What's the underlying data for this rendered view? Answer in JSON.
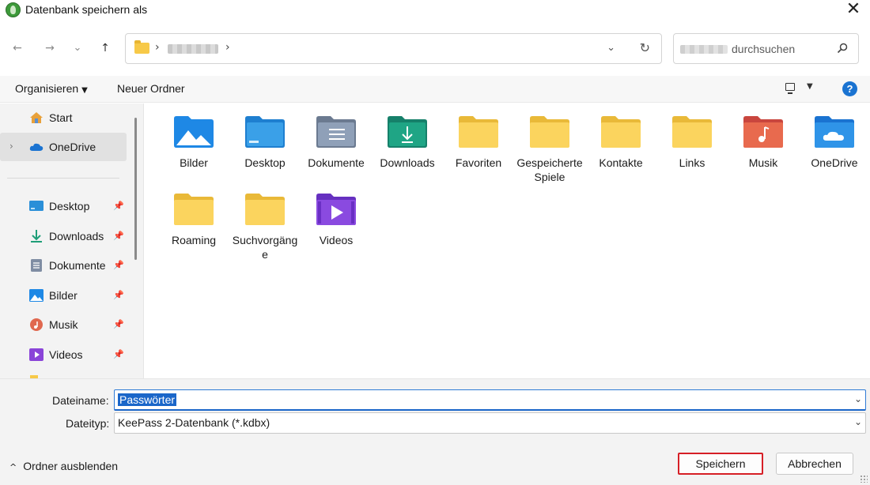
{
  "window": {
    "title": "Datenbank speichern als",
    "close_glyph": "✕"
  },
  "nav": {
    "back_glyph": "←",
    "forward_glyph": "→",
    "recent_glyph": "⌄",
    "up_glyph": "↑",
    "breadcrumb_separator": "›",
    "search_suffix": "durchsuchen",
    "address_dropdown_glyph": "⌄",
    "refresh_glyph": "↻"
  },
  "commandbar": {
    "organize_label": "Organisieren",
    "new_folder_label": "Neuer Ordner",
    "help_glyph": "?"
  },
  "sidebar": {
    "items": [
      {
        "label": "Start",
        "icon": "home-icon"
      },
      {
        "label": "OneDrive",
        "icon": "onedrive-icon",
        "selected": true
      },
      {
        "label": "Desktop",
        "icon": "desktop-icon",
        "pinned": true
      },
      {
        "label": "Downloads",
        "icon": "download-icon",
        "pinned": true
      },
      {
        "label": "Dokumente",
        "icon": "document-icon",
        "pinned": true
      },
      {
        "label": "Bilder",
        "icon": "pictures-icon",
        "pinned": true
      },
      {
        "label": "Musik",
        "icon": "music-icon",
        "pinned": true
      },
      {
        "label": "Videos",
        "icon": "videos-icon",
        "pinned": true
      }
    ],
    "expander_glyph": "›",
    "pin_glyph": "📌"
  },
  "folders": [
    {
      "label": "Bilder",
      "icon": "pictures-folder-icon",
      "color": "#1e88e5"
    },
    {
      "label": "Desktop",
      "icon": "desktop-folder-icon",
      "color": "#1e7fd0"
    },
    {
      "label": "Dokumente",
      "icon": "documents-folder-icon",
      "color": "#6b7a90"
    },
    {
      "label": "Downloads",
      "icon": "downloads-folder-icon",
      "color": "#1e9e78"
    },
    {
      "label": "Favoriten",
      "icon": "folder-icon",
      "color": "#f7c948"
    },
    {
      "label": "Gespeicherte Spiele",
      "icon": "folder-icon",
      "color": "#f7c948"
    },
    {
      "label": "Kontakte",
      "icon": "folder-icon",
      "color": "#f7c948"
    },
    {
      "label": "Links",
      "icon": "folder-icon",
      "color": "#f7c948"
    },
    {
      "label": "Musik",
      "icon": "music-folder-icon",
      "color": "#e0584f"
    },
    {
      "label": "OneDrive",
      "icon": "onedrive-folder-icon",
      "color": "#2a8be0"
    },
    {
      "label": "Roaming",
      "icon": "folder-icon",
      "color": "#f7c948"
    },
    {
      "label": "Suchvorgänge",
      "icon": "folder-icon",
      "color": "#f7c948"
    },
    {
      "label": "Videos",
      "icon": "videos-folder-icon",
      "color": "#7b3fd6"
    }
  ],
  "form": {
    "filename_label": "Dateiname:",
    "filename_value": "Passwörter",
    "filetype_label": "Dateityp:",
    "filetype_value": "KeePass 2-Datenbank (*.kdbx)",
    "dropdown_glyph": "⌄"
  },
  "footer": {
    "hide_folders_label": "Ordner ausblenden",
    "hide_folders_glyph": "^",
    "save_label": "Speichern",
    "cancel_label": "Abbrechen"
  }
}
